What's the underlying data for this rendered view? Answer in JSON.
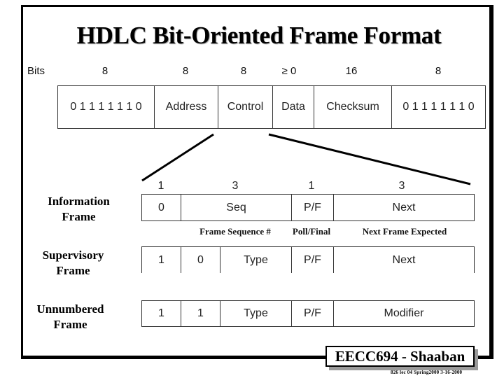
{
  "title": "HDLC Bit-Oriented Frame Format",
  "top_frame": {
    "bits_label": "Bits",
    "fields": [
      {
        "label": "0 1 1 1 1 1 1 0",
        "bits": "8"
      },
      {
        "label": "Address",
        "bits": "8"
      },
      {
        "label": "Control",
        "bits": "8"
      },
      {
        "label": "Data",
        "bits": "≥ 0"
      },
      {
        "label": "Checksum",
        "bits": "16"
      },
      {
        "label": "0 1 1 1 1 1 1 0",
        "bits": "8"
      }
    ]
  },
  "control_bits": [
    "1",
    "3",
    "1",
    "3"
  ],
  "frames": {
    "information": {
      "label_line1": "Information",
      "label_line2": "Frame",
      "cells": [
        "0",
        "Seq",
        "P/F",
        "Next"
      ],
      "captions": [
        "Frame Sequence #",
        "Poll/Final",
        "Next Frame Expected"
      ]
    },
    "supervisory": {
      "label_line1": "Supervisory",
      "label_line2": "Frame",
      "cells": [
        "1",
        "0",
        "Type",
        "P/F",
        "Next"
      ]
    },
    "unnumbered": {
      "label_line1": "Unnumbered",
      "label_line2": "Frame",
      "cells": [
        "1",
        "1",
        "Type",
        "P/F",
        "Modifier"
      ]
    }
  },
  "footer": {
    "title": "EECC694 - Shaaban",
    "subtitle": "826 lec 04 Spring2000 3-16-2000"
  }
}
